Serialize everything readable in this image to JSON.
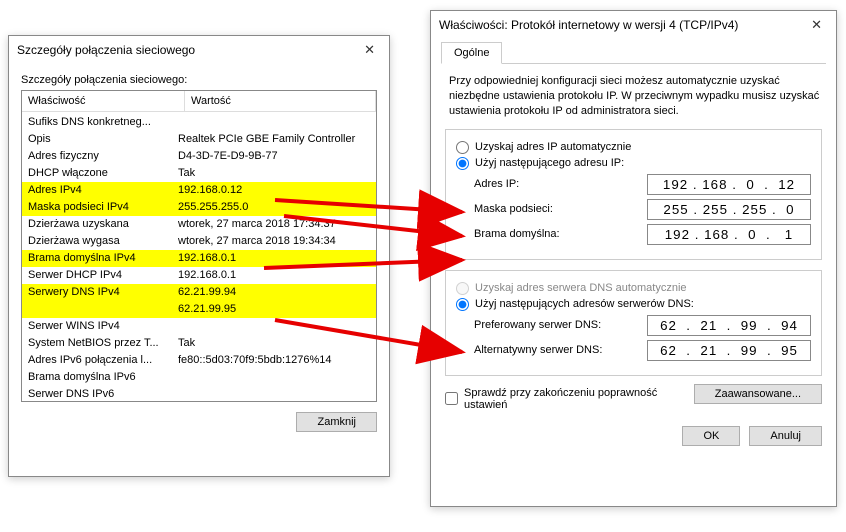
{
  "left": {
    "title": "Szczegóły połączenia sieciowego",
    "subtitle": "Szczegóły połączenia sieciowego:",
    "col1": "Właściwość",
    "col2": "Wartość",
    "rows": [
      {
        "p": "Sufiks DNS konkretneg...",
        "v": "",
        "hl": false
      },
      {
        "p": "Opis",
        "v": "Realtek PCIe GBE Family Controller",
        "hl": false
      },
      {
        "p": "Adres fizyczny",
        "v": "D4-3D-7E-D9-9B-77",
        "hl": false
      },
      {
        "p": "DHCP włączone",
        "v": "Tak",
        "hl": false
      },
      {
        "p": "Adres IPv4",
        "v": "192.168.0.12",
        "hl": true
      },
      {
        "p": "Maska podsieci IPv4",
        "v": "255.255.255.0",
        "hl": true
      },
      {
        "p": "Dzierżawa uzyskana",
        "v": "wtorek, 27 marca 2018 17:34:37",
        "hl": false
      },
      {
        "p": "Dzierżawa wygasa",
        "v": "wtorek, 27 marca 2018 19:34:34",
        "hl": false
      },
      {
        "p": "Brama domyślna IPv4",
        "v": "192.168.0.1",
        "hl": true
      },
      {
        "p": "Serwer DHCP IPv4",
        "v": "192.168.0.1",
        "hl": false
      },
      {
        "p": "Serwery DNS IPv4",
        "v": "62.21.99.94",
        "hl": true
      },
      {
        "p": "",
        "v": "62.21.99.95",
        "hl": true
      },
      {
        "p": "Serwer WINS IPv4",
        "v": "",
        "hl": false
      },
      {
        "p": "System NetBIOS przez T...",
        "v": "Tak",
        "hl": false
      },
      {
        "p": "Adres IPv6 połączenia l...",
        "v": "fe80::5d03:70f9:5bdb:1276%14",
        "hl": false
      },
      {
        "p": "Brama domyślna IPv6",
        "v": "",
        "hl": false
      },
      {
        "p": "Serwer DNS IPv6",
        "v": "",
        "hl": false
      }
    ],
    "close_btn": "Zamknij"
  },
  "right": {
    "title": "Właściwości: Protokół internetowy w wersji 4 (TCP/IPv4)",
    "tab": "Ogólne",
    "intro": "Przy odpowiedniej konfiguracji sieci możesz automatycznie uzyskać niezbędne ustawienia protokołu IP. W przeciwnym wypadku musisz uzyskać ustawienia protokołu IP od administratora sieci.",
    "ip_auto": "Uzyskaj adres IP automatycznie",
    "ip_manual": "Użyj następującego adresu IP:",
    "ip_label": "Adres IP:",
    "ip_val": "192 . 168 .  0  .  12",
    "mask_label": "Maska podsieci:",
    "mask_val": "255 . 255 . 255 .  0",
    "gw_label": "Brama domyślna:",
    "gw_val": "192 . 168 .  0  .   1",
    "dns_auto": "Uzyskaj adres serwera DNS automatycznie",
    "dns_manual": "Użyj następujących adresów serwerów DNS:",
    "dns1_label": "Preferowany serwer DNS:",
    "dns1_val": "62  .  21  .  99  .  94",
    "dns2_label": "Alternatywny serwer DNS:",
    "dns2_val": "62  .  21  .  99  .  95",
    "validate": "Sprawdź przy zakończeniu poprawność ustawień",
    "advanced": "Zaawansowane...",
    "ok": "OK",
    "cancel": "Anuluj"
  }
}
